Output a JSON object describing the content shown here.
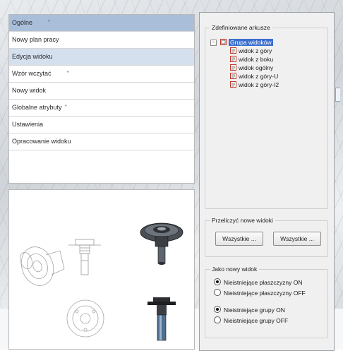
{
  "menu": {
    "items": [
      {
        "label": "Ogólne",
        "mark": "\"",
        "state": "active"
      },
      {
        "label": "Nowy plan pracy",
        "mark": "",
        "state": "normal"
      },
      {
        "label": "Edycja widoku",
        "mark": "",
        "state": "hover"
      },
      {
        "label": "Wzór wczytać",
        "mark": "\"",
        "state": "normal"
      },
      {
        "label": "Nowy widok",
        "mark": "",
        "state": "normal"
      },
      {
        "label": "Globalne atrybuty",
        "mark": "\"",
        "state": "normal"
      },
      {
        "label": "Ustawienia",
        "mark": "",
        "state": "normal"
      },
      {
        "label": "Opracowanie widoku",
        "mark": "",
        "state": "normal"
      }
    ]
  },
  "dialog": {
    "defined_sheets": {
      "legend": "Zdefiniowane arkusze",
      "root": "Grupa widoków",
      "children": [
        "widok z góry",
        "widok z boku",
        "widok ogólny",
        "widok z góry-U",
        "widok z góry-I2"
      ]
    },
    "recalc": {
      "legend": "Przeliczyć nowe widoki",
      "button1": "Wszystkie ...",
      "button2": "Wszystkie ..."
    },
    "as_new_view": {
      "legend": "Jako nowy widok",
      "options": [
        {
          "label": "Nieistniejące płaszczyzny ON",
          "checked": true
        },
        {
          "label": "Nieistniejące płaszczyzny OFF",
          "checked": false
        },
        {
          "label": "Nieistniejące grupy ON",
          "checked": true
        },
        {
          "label": "Nieistniejące grupy OFF",
          "checked": false
        }
      ]
    }
  },
  "colors": {
    "selection": "#3b6ecf",
    "menu_active": "#a9bfd9",
    "menu_hover": "#d4e0ee",
    "node_icon": "#c0392b"
  }
}
